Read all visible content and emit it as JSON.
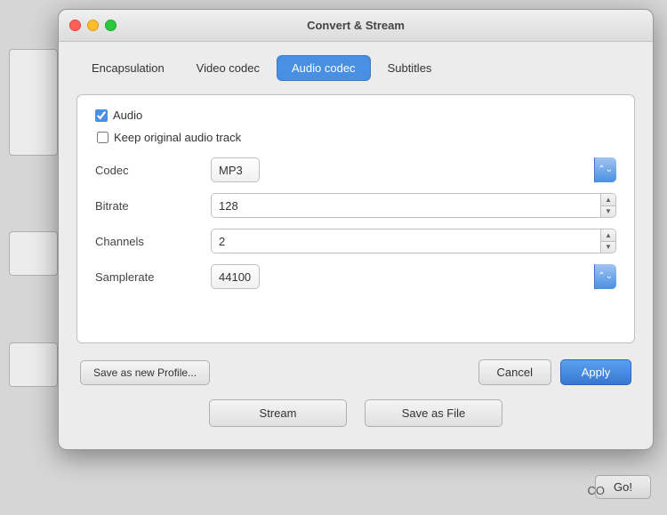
{
  "window": {
    "title": "Convert & Stream",
    "controls": {
      "close": "close",
      "minimize": "minimize",
      "maximize": "maximize"
    }
  },
  "tabs": [
    {
      "id": "encapsulation",
      "label": "Encapsulation",
      "active": false
    },
    {
      "id": "video-codec",
      "label": "Video codec",
      "active": false
    },
    {
      "id": "audio-codec",
      "label": "Audio codec",
      "active": true
    },
    {
      "id": "subtitles",
      "label": "Subtitles",
      "active": false
    }
  ],
  "form": {
    "audio_checkbox": {
      "label": "Audio",
      "checked": true
    },
    "keep_original": {
      "label": "Keep original audio track",
      "checked": false
    },
    "fields": [
      {
        "id": "codec",
        "label": "Codec",
        "type": "select",
        "value": "MP3"
      },
      {
        "id": "bitrate",
        "label": "Bitrate",
        "type": "spinner",
        "value": "128"
      },
      {
        "id": "channels",
        "label": "Channels",
        "type": "spinner",
        "value": "2"
      },
      {
        "id": "samplerate",
        "label": "Samplerate",
        "type": "select",
        "value": "44100"
      }
    ]
  },
  "buttons": {
    "save_profile": "Save as new Profile...",
    "cancel": "Cancel",
    "apply": "Apply",
    "stream": "Stream",
    "save_as_file": "Save as File",
    "go": "Go!"
  },
  "co_label": "CO"
}
